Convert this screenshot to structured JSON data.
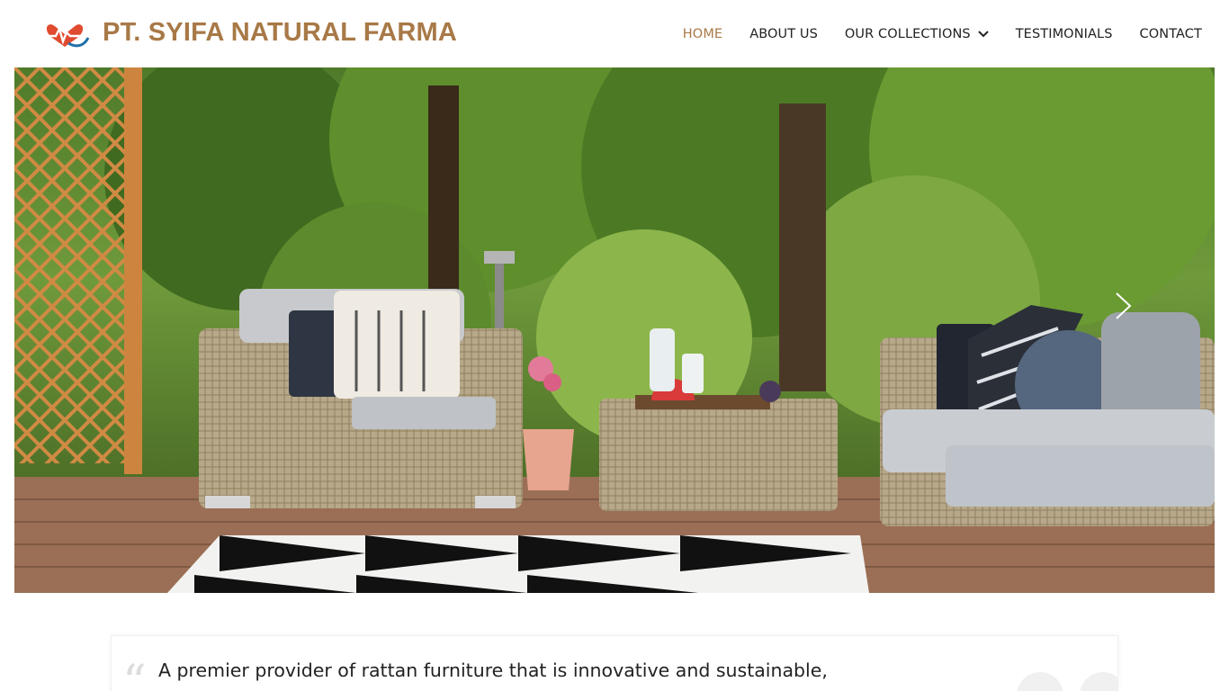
{
  "brand": {
    "name": "PT. SYIFA NATURAL FARMA",
    "logo_icon": "heart-pulse-icon",
    "color": "#a87947"
  },
  "nav": {
    "items": [
      {
        "label": "HOME",
        "active": true
      },
      {
        "label": "ABOUT US",
        "active": false
      },
      {
        "label": "OUR COLLECTIONS",
        "active": false,
        "has_dropdown": true
      },
      {
        "label": "TESTIMONIALS",
        "active": false
      },
      {
        "label": "CONTACT",
        "active": false
      }
    ],
    "active_color": "#a87947"
  },
  "hero": {
    "image": "rattan-patio-furniture-photo",
    "next_icon": "chevron-right-icon"
  },
  "quote": {
    "text": "A premier provider of rattan furniture that is innovative and sustainable,"
  }
}
